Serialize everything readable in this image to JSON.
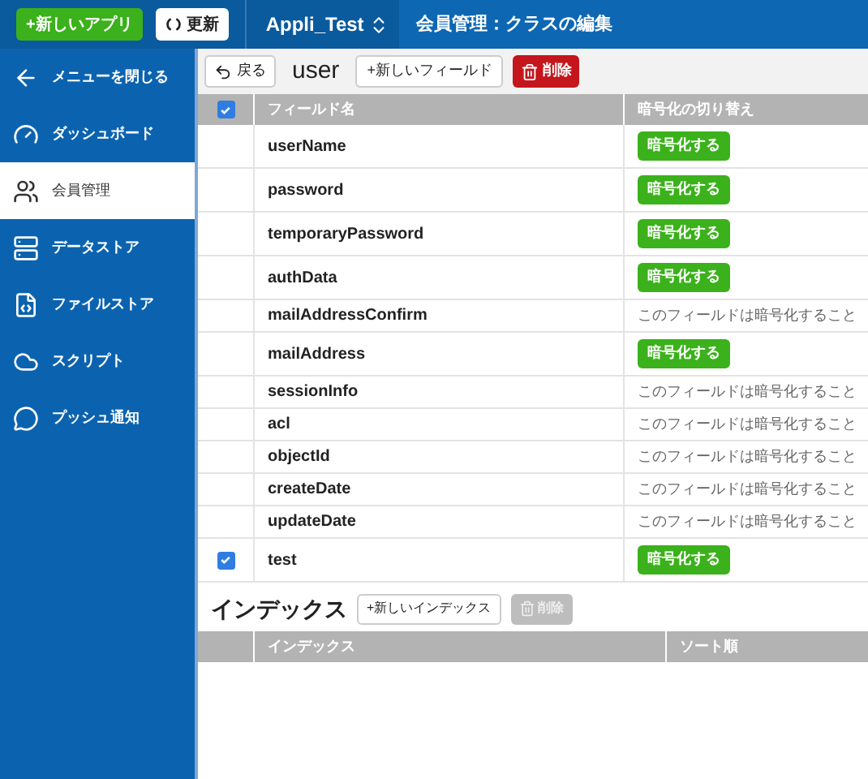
{
  "topbar": {
    "new_app": "+新しいアプリ",
    "refresh": "更新",
    "app_name": "Appli_Test",
    "breadcrumb": "会員管理：クラスの編集"
  },
  "sidebar": {
    "items": [
      {
        "kind": "close",
        "label": "メニューを閉じる",
        "selected": false
      },
      {
        "kind": "dashboard",
        "label": "ダッシュボード",
        "selected": false
      },
      {
        "kind": "members",
        "label": "会員管理",
        "selected": true
      },
      {
        "kind": "datastore",
        "label": "データストア",
        "selected": false
      },
      {
        "kind": "filestore",
        "label": "ファイルストア",
        "selected": false
      },
      {
        "kind": "script",
        "label": "スクリプト",
        "selected": false
      },
      {
        "kind": "push",
        "label": "プッシュ通知",
        "selected": false
      }
    ]
  },
  "toolbar": {
    "back": "戻る",
    "class_name": "user",
    "new_field": "+新しいフィールド",
    "delete": "削除"
  },
  "fields_table": {
    "header_checked": true,
    "columns": [
      "フィールド名",
      "暗号化の切り替え"
    ],
    "rows": [
      {
        "name": "userName",
        "checked": false,
        "kind": "button",
        "encrypt": "暗号化する"
      },
      {
        "name": "password",
        "checked": false,
        "kind": "button",
        "encrypt": "暗号化する"
      },
      {
        "name": "temporaryPassword",
        "checked": false,
        "kind": "button",
        "encrypt": "暗号化する"
      },
      {
        "name": "authData",
        "checked": false,
        "kind": "button",
        "encrypt": "暗号化する"
      },
      {
        "name": "mailAddressConfirm",
        "checked": false,
        "kind": "note",
        "encrypt": "このフィールドは暗号化すること"
      },
      {
        "name": "mailAddress",
        "checked": false,
        "kind": "button",
        "encrypt": "暗号化する"
      },
      {
        "name": "sessionInfo",
        "checked": false,
        "kind": "note",
        "encrypt": "このフィールドは暗号化すること"
      },
      {
        "name": "acl",
        "checked": false,
        "kind": "note",
        "encrypt": "このフィールドは暗号化すること"
      },
      {
        "name": "objectId",
        "checked": false,
        "kind": "note",
        "encrypt": "このフィールドは暗号化すること"
      },
      {
        "name": "createDate",
        "checked": false,
        "kind": "note",
        "encrypt": "このフィールドは暗号化すること"
      },
      {
        "name": "updateDate",
        "checked": false,
        "kind": "note",
        "encrypt": "このフィールドは暗号化すること"
      },
      {
        "name": "test",
        "checked": true,
        "kind": "button",
        "encrypt": "暗号化する"
      }
    ]
  },
  "index": {
    "title": "インデックス",
    "new_index": "+新しいインデックス",
    "delete": "削除",
    "delete_disabled": true,
    "columns": [
      "インデックス",
      "ソート順"
    ]
  }
}
